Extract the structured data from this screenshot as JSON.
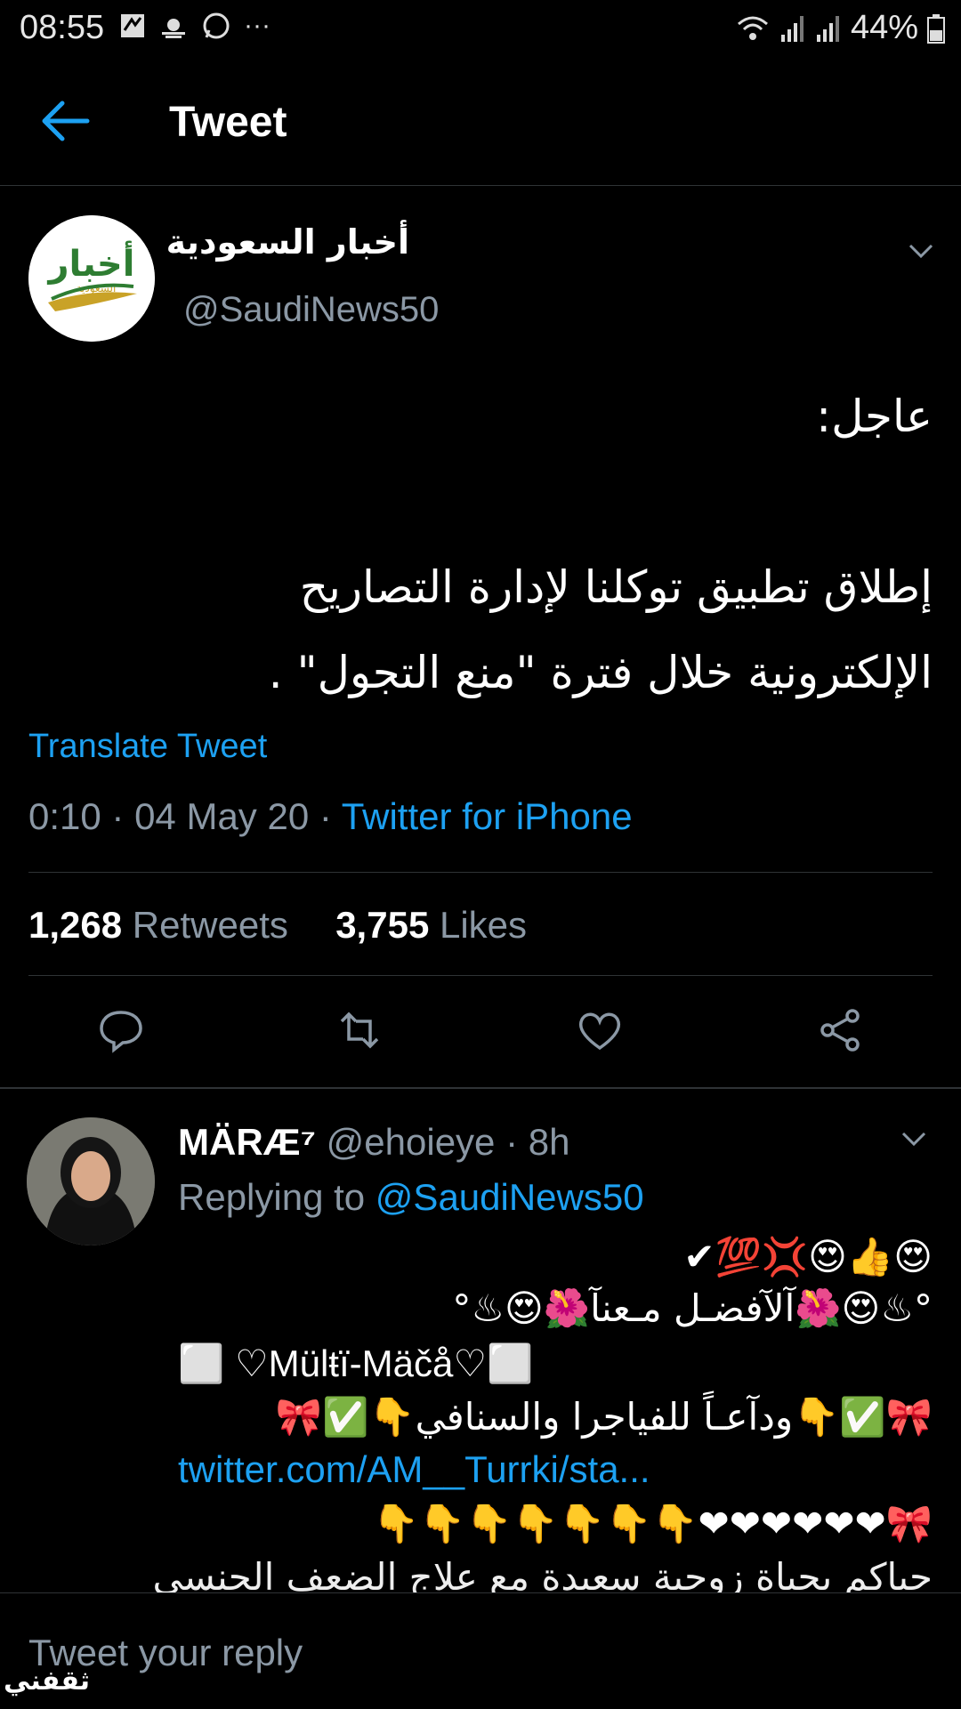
{
  "status_bar": {
    "time": "08:55",
    "battery": "44%",
    "more": "···"
  },
  "header": {
    "title": "Tweet"
  },
  "tweet": {
    "author_name": "أخبار السعودية",
    "handle": "@SaudiNews50",
    "avatar_logo_text": "أخبار",
    "avatar_logo_sub": "السعودية",
    "text": "عاجل:\n\nإطلاق تطبيق توكلنا لإدارة التصاريح\nالإلكترونية خلال فترة \"منع التجول\" .",
    "translate": "Translate Tweet",
    "time": "0:10",
    "date": "04 May 20",
    "source": "Twitter for iPhone",
    "retweets_count": "1,268",
    "retweets_label": "Retweets",
    "likes_count": "3,755",
    "likes_label": "Likes"
  },
  "reply": {
    "name": "MÄRÆ⁷",
    "handle": "@ehoieye",
    "age": "· 8h",
    "replying_prefix": "Replying to",
    "replying_to": "@SaudiNews50",
    "lines": [
      "✔💯💢😍👍😍",
      "°♨😍🌺آلآفضـل مـعنآ🌺😍♨°",
      "⬜ ♡Mülŧï-Mäčå♡⬜",
      "🎀✅👇ودآعـاً للفياجرا والسنافي👇✅🎀",
      "👇👇👇👇👇👇👇❤❤❤❤❤❤🎀",
      "حياكم بحياة زوجية سعيدة مع علاج الضعف الجنسي"
    ],
    "link": "twitter.com/AM__Turrki/sta..."
  },
  "compose": {
    "placeholder": "Tweet your reply"
  },
  "watermark": "ثقفني",
  "colors": {
    "accent": "#1da1f2",
    "muted": "#8b98a5",
    "divider": "#2f3336"
  }
}
